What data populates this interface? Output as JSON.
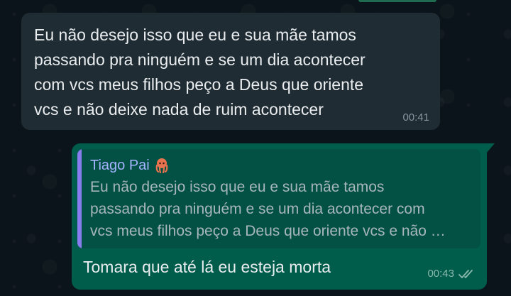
{
  "chat": {
    "incoming": {
      "lines": [
        "Eu não desejo isso que eu e sua mãe tamos",
        "passando pra ninguém e se um dia acontecer",
        "com vcs meus filhos peço a Deus que oriente",
        "vcs e não deixe nada de ruim acontecer"
      ],
      "time": "00:41"
    },
    "outgoing": {
      "quote": {
        "author": "Tiago Pai",
        "author_emoji": "octopus-emoji",
        "lines": [
          "Eu não desejo isso que eu e sua mãe tamos",
          "passando pra ninguém e se um dia acontecer com",
          "vcs meus filhos peço a Deus que oriente vcs e não …"
        ]
      },
      "text": "Tomara que até lá eu esteja morta",
      "time": "00:43",
      "status_icon": "double-check-icon"
    }
  },
  "colors": {
    "background": "#0b141a",
    "incoming_bubble": "#202c33",
    "outgoing_bubble": "#005c4b",
    "quote_bar": "#8a7cf0",
    "quote_author": "#a5b3ff"
  }
}
